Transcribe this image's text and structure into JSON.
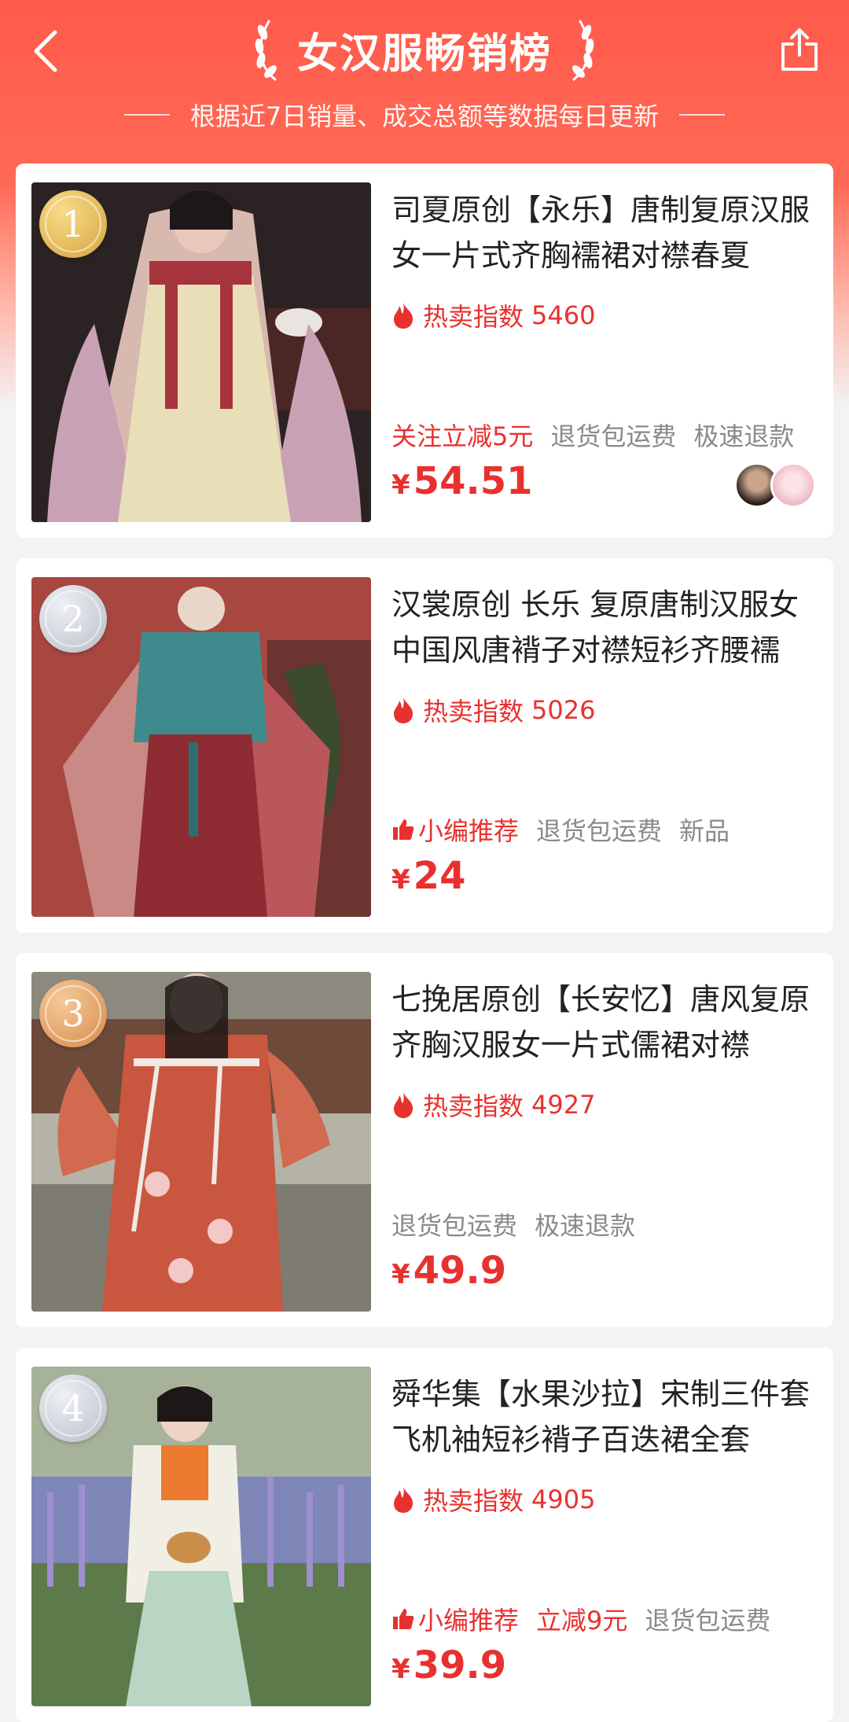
{
  "header": {
    "title": "女汉服畅销榜",
    "subtitle": "根据近7日销量、成交总额等数据每日更新",
    "back_icon": "back-arrow-icon",
    "share_icon": "share-icon"
  },
  "products": [
    {
      "rank": "1",
      "title": "司夏原创【永乐】唐制复原汉服女一片式齐胸襦裙对襟春夏",
      "hot_label": "热卖指数",
      "hot_value": "5460",
      "tags": [
        "关注立减5元",
        "退货包运费",
        "极速退款"
      ],
      "price_symbol": "¥",
      "price": "54.51"
    },
    {
      "rank": "2",
      "title": "汉裳原创 长乐 复原唐制汉服女中国风唐褙子对襟短衫齐腰襦",
      "hot_label": "热卖指数",
      "hot_value": "5026",
      "tags": [
        "小编推荐",
        "退货包运费",
        "新品"
      ],
      "price_symbol": "¥",
      "price": "24"
    },
    {
      "rank": "3",
      "title": "七挽居原创【长安忆】唐风复原齐胸汉服女一片式儒裙对襟",
      "hot_label": "热卖指数",
      "hot_value": "4927",
      "tags": [
        "退货包运费",
        "极速退款"
      ],
      "price_symbol": "¥",
      "price": "49.9"
    },
    {
      "rank": "4",
      "title": "舜华集【水果沙拉】宋制三件套飞机袖短衫褙子百迭裙全套",
      "hot_label": "热卖指数",
      "hot_value": "4905",
      "tags": [
        "小编推荐",
        "立减9元",
        "退货包运费"
      ],
      "price_symbol": "¥",
      "price": "39.9"
    }
  ],
  "colors": {
    "accent": "#e8312f",
    "header": "#ff5a4c",
    "muted": "#8a8a8a"
  }
}
